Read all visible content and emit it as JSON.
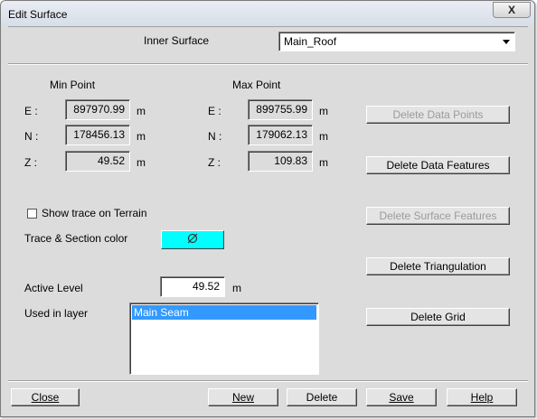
{
  "window": {
    "title": "Edit Surface",
    "close_glyph": "X"
  },
  "inner_surface": {
    "label": "Inner Surface",
    "value": "Main_Roof"
  },
  "min_point": {
    "heading": "Min Point",
    "e_label": "E :",
    "e_value": "897970.99",
    "n_label": "N :",
    "n_value": "178456.13",
    "z_label": "Z :",
    "z_value": "49.52",
    "unit": "m"
  },
  "max_point": {
    "heading": "Max Point",
    "e_label": "E :",
    "e_value": "899755.99",
    "n_label": "N :",
    "n_value": "179062.13",
    "z_label": "Z :",
    "z_value": "109.83",
    "unit": "m"
  },
  "side_buttons": {
    "delete_data_points": "Delete Data Points",
    "delete_data_features": "Delete Data Features",
    "delete_surface_features": "Delete Surface Features",
    "delete_triangulation": "Delete Triangulation",
    "delete_grid": "Delete Grid"
  },
  "show_trace": {
    "label": "Show trace on Terrain",
    "checked": false
  },
  "trace_color": {
    "label": "Trace & Section color",
    "color": "#00ffff",
    "icon": "color-picker-icon"
  },
  "active_level": {
    "label": "Active Level",
    "value": "49.52",
    "unit": "m"
  },
  "used_in_layer": {
    "label": "Used in layer",
    "items": [
      "Main Seam"
    ],
    "selection_color": "#3399ff"
  },
  "bottom_buttons": {
    "close": "Close",
    "new": "New",
    "delete": "Delete",
    "save": "Save",
    "help": "Help"
  }
}
